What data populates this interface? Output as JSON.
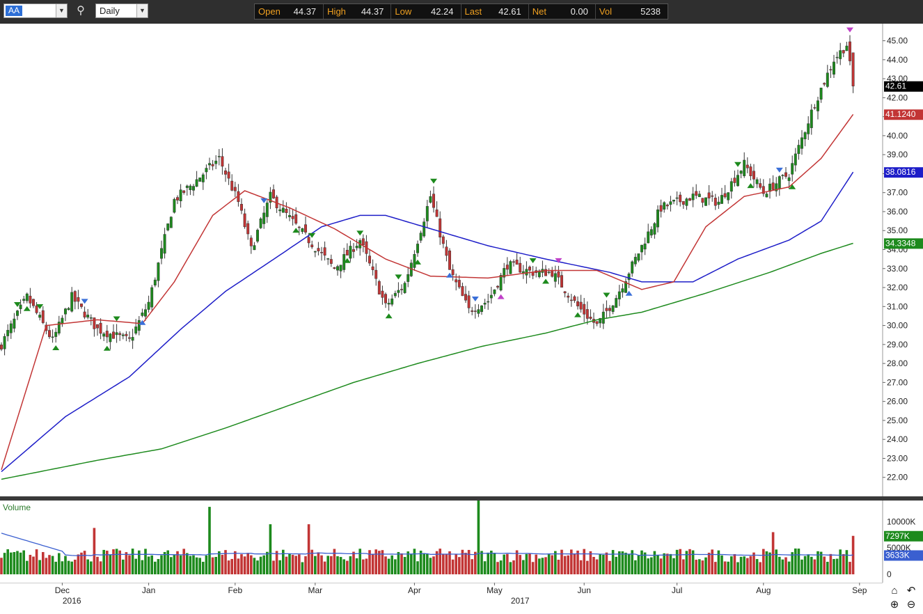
{
  "toolbar": {
    "symbol": "AA",
    "period": "Daily",
    "search_icon": "search-icon",
    "quote": {
      "open_label": "Open",
      "open": "44.37",
      "high_label": "High",
      "high": "44.37",
      "low_label": "Low",
      "low": "42.24",
      "last_label": "Last",
      "last": "42.61",
      "net_label": "Net",
      "net": "0.00",
      "vol_label": "Vol",
      "vol": "5238"
    }
  },
  "colors": {
    "up": "#1d8a1d",
    "down": "#c23535",
    "ma20": "#c23535",
    "ma50": "#1d1dc8",
    "ma200": "#1d8a1d",
    "vol_ma": "#3a5fd0",
    "bg_dark": "#2f2f2f"
  },
  "chart_data": [
    {
      "type": "candlestick",
      "y_ticks": [
        "22.00",
        "23.00",
        "24.00",
        "25.00",
        "26.00",
        "27.00",
        "28.00",
        "29.00",
        "30.00",
        "31.00",
        "32.00",
        "33.00",
        "34.00",
        "35.00",
        "36.00",
        "37.00",
        "38.00",
        "39.00",
        "40.00",
        "41.00",
        "42.00",
        "43.00",
        "44.00",
        "45.00"
      ],
      "ylim": [
        21.0,
        45.9
      ],
      "last_price": {
        "value": 42.61,
        "label": "42.61"
      },
      "ma_tags": [
        {
          "name": "ma20",
          "value": 41.124,
          "label": "41.1240"
        },
        {
          "name": "ma50",
          "value": 38.0816,
          "label": "38.0816"
        },
        {
          "name": "ma200",
          "value": 34.3348,
          "label": "34.3348"
        }
      ],
      "close_keypoints": [
        [
          0,
          29.0
        ],
        [
          8,
          31.5
        ],
        [
          16,
          29.2
        ],
        [
          22,
          31.5
        ],
        [
          30,
          29.8
        ],
        [
          40,
          29.2
        ],
        [
          46,
          31.2
        ],
        [
          54,
          36.6
        ],
        [
          60,
          37.5
        ],
        [
          68,
          38.8
        ],
        [
          74,
          36.5
        ],
        [
          78,
          34.0
        ],
        [
          84,
          36.8
        ],
        [
          96,
          34.5
        ],
        [
          104,
          33.0
        ],
        [
          112,
          34.5
        ],
        [
          120,
          31.0
        ],
        [
          126,
          32.2
        ],
        [
          134,
          36.8
        ],
        [
          140,
          32.9
        ],
        [
          146,
          30.8
        ],
        [
          152,
          31.3
        ],
        [
          158,
          33.2
        ],
        [
          166,
          32.8
        ],
        [
          172,
          32.8
        ],
        [
          180,
          31.0
        ],
        [
          186,
          30.0
        ],
        [
          192,
          31.5
        ],
        [
          198,
          33.5
        ],
        [
          206,
          36.2
        ],
        [
          216,
          36.8
        ],
        [
          224,
          36.5
        ],
        [
          232,
          38.5
        ],
        [
          238,
          37.0
        ],
        [
          246,
          38.0
        ],
        [
          254,
          41.7
        ],
        [
          260,
          44.0
        ],
        [
          264,
          44.8
        ],
        [
          266,
          42.61
        ]
      ],
      "ma20_keypoints": [
        [
          0,
          22.4
        ],
        [
          14,
          30.0
        ],
        [
          30,
          30.3
        ],
        [
          44,
          30.1
        ],
        [
          54,
          32.3
        ],
        [
          66,
          35.8
        ],
        [
          76,
          37.1
        ],
        [
          90,
          36.2
        ],
        [
          104,
          35.1
        ],
        [
          120,
          33.5
        ],
        [
          134,
          32.6
        ],
        [
          152,
          32.5
        ],
        [
          170,
          32.9
        ],
        [
          186,
          32.9
        ],
        [
          200,
          31.9
        ],
        [
          210,
          32.3
        ],
        [
          220,
          35.2
        ],
        [
          232,
          36.8
        ],
        [
          246,
          37.3
        ],
        [
          256,
          38.8
        ],
        [
          266,
          41.12
        ]
      ],
      "ma50_keypoints": [
        [
          0,
          22.3
        ],
        [
          20,
          25.2
        ],
        [
          40,
          27.3
        ],
        [
          56,
          29.8
        ],
        [
          70,
          31.8
        ],
        [
          86,
          33.6
        ],
        [
          100,
          35.2
        ],
        [
          112,
          35.8
        ],
        [
          120,
          35.8
        ],
        [
          136,
          35.0
        ],
        [
          152,
          34.2
        ],
        [
          170,
          33.5
        ],
        [
          190,
          32.8
        ],
        [
          200,
          32.3
        ],
        [
          216,
          32.3
        ],
        [
          230,
          33.5
        ],
        [
          246,
          34.5
        ],
        [
          256,
          35.5
        ],
        [
          266,
          38.08
        ]
      ],
      "ma200_keypoints": [
        [
          0,
          21.9
        ],
        [
          30,
          22.9
        ],
        [
          50,
          23.5
        ],
        [
          70,
          24.6
        ],
        [
          90,
          25.8
        ],
        [
          110,
          27.0
        ],
        [
          130,
          28.0
        ],
        [
          150,
          28.9
        ],
        [
          170,
          29.6
        ],
        [
          186,
          30.3
        ],
        [
          200,
          30.7
        ],
        [
          220,
          31.7
        ],
        [
          240,
          32.8
        ],
        [
          256,
          33.8
        ],
        [
          266,
          34.33
        ]
      ],
      "pivots": [
        {
          "i": 5,
          "kind": "high",
          "color": "green"
        },
        {
          "i": 8,
          "kind": "low",
          "color": "green"
        },
        {
          "i": 12,
          "kind": "high",
          "color": "green"
        },
        {
          "i": 17,
          "kind": "low",
          "color": "green"
        },
        {
          "i": 26,
          "kind": "high",
          "color": "blue"
        },
        {
          "i": 33,
          "kind": "low",
          "color": "green"
        },
        {
          "i": 36,
          "kind": "high",
          "color": "green"
        },
        {
          "i": 44,
          "kind": "low",
          "color": "blue"
        },
        {
          "i": 82,
          "kind": "high",
          "color": "blue"
        },
        {
          "i": 92,
          "kind": "low",
          "color": "green"
        },
        {
          "i": 97,
          "kind": "high",
          "color": "green"
        },
        {
          "i": 108,
          "kind": "low",
          "color": "green"
        },
        {
          "i": 112,
          "kind": "high",
          "color": "green"
        },
        {
          "i": 121,
          "kind": "low",
          "color": "green"
        },
        {
          "i": 124,
          "kind": "high",
          "color": "green"
        },
        {
          "i": 130,
          "kind": "low",
          "color": "green"
        },
        {
          "i": 135,
          "kind": "high",
          "color": "green"
        },
        {
          "i": 140,
          "kind": "low",
          "color": "blue"
        },
        {
          "i": 148,
          "kind": "high",
          "color": "blue"
        },
        {
          "i": 156,
          "kind": "low",
          "color": "magenta"
        },
        {
          "i": 166,
          "kind": "high",
          "color": "green"
        },
        {
          "i": 170,
          "kind": "low",
          "color": "green"
        },
        {
          "i": 174,
          "kind": "high",
          "color": "magenta"
        },
        {
          "i": 180,
          "kind": "low",
          "color": "green"
        },
        {
          "i": 189,
          "kind": "high",
          "color": "green"
        },
        {
          "i": 196,
          "kind": "low",
          "color": "blue"
        },
        {
          "i": 230,
          "kind": "high",
          "color": "green"
        },
        {
          "i": 234,
          "kind": "low",
          "color": "green"
        },
        {
          "i": 243,
          "kind": "high",
          "color": "blue"
        },
        {
          "i": 247,
          "kind": "low",
          "color": "green"
        },
        {
          "i": 265,
          "kind": "high",
          "color": "magenta"
        }
      ]
    },
    {
      "type": "bar",
      "title": "Volume",
      "y_ticks": [
        {
          "value": 0,
          "label": "0"
        },
        {
          "value": 5000,
          "label": "5000K"
        },
        {
          "value": 10000,
          "label": "10000K"
        }
      ],
      "ylim": [
        0,
        14000
      ],
      "tags": [
        {
          "name": "vol-last",
          "value": 7297,
          "label": "7297K",
          "color": "#1d8a1d"
        },
        {
          "name": "vol-ma",
          "value": 3633,
          "label": "3633K",
          "color": "#3a5fd0"
        }
      ],
      "spike_keypoints": [
        [
          65,
          12800
        ],
        [
          149,
          14000
        ],
        [
          29,
          8800
        ],
        [
          84,
          9500
        ],
        [
          96,
          9500
        ],
        [
          241,
          8000
        ],
        [
          266,
          7297
        ]
      ]
    }
  ],
  "x_axis": {
    "months": [
      {
        "label": "Dec",
        "i": 19
      },
      {
        "label": "Jan",
        "i": 46
      },
      {
        "label": "Feb",
        "i": 73
      },
      {
        "label": "Mar",
        "i": 98
      },
      {
        "label": "Apr",
        "i": 129
      },
      {
        "label": "May",
        "i": 154
      },
      {
        "label": "Jun",
        "i": 182
      },
      {
        "label": "Jul",
        "i": 211
      },
      {
        "label": "Aug",
        "i": 238
      },
      {
        "label": "Sep",
        "i": 268
      }
    ],
    "years": [
      {
        "label": "2016",
        "i": 22
      },
      {
        "label": "2017",
        "i": 162
      }
    ]
  },
  "nav": {
    "home": "home-icon",
    "reset": "reset-icon",
    "zoom_in": "zoom-in-icon",
    "zoom_out": "zoom-out-icon"
  }
}
